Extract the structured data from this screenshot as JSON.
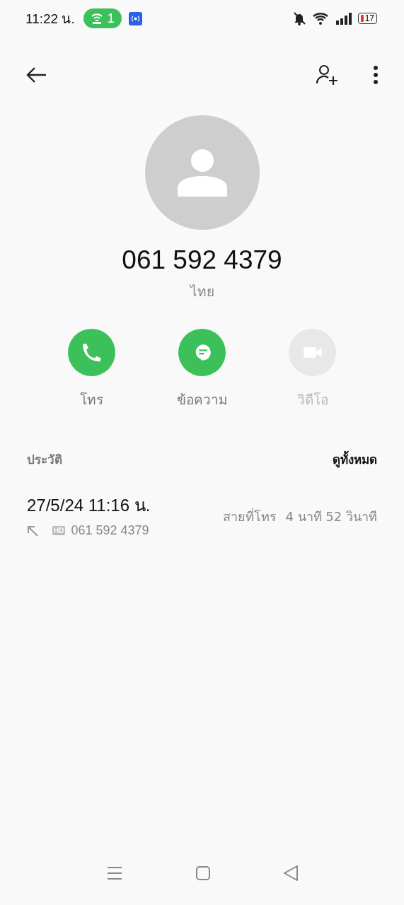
{
  "status_bar": {
    "time": "11:22 น.",
    "hotspot_count": "1",
    "battery": "17"
  },
  "contact": {
    "number": "061 592 4379",
    "location": "ไทย"
  },
  "actions": [
    {
      "kind": "call",
      "label": "โทร",
      "disabled": false
    },
    {
      "kind": "message",
      "label": "ข้อความ",
      "disabled": false
    },
    {
      "kind": "video",
      "label": "วิดีโอ",
      "disabled": true
    }
  ],
  "history": {
    "title": "ประวัติ",
    "see_all": "ดูทั้งหมด",
    "entries": [
      {
        "datetime": "27/5/24 11:16 น.",
        "badge": "HD",
        "number": "061 592 4379",
        "type": "สายที่โทร",
        "duration": "4 นาที 52 วินาที"
      }
    ]
  }
}
